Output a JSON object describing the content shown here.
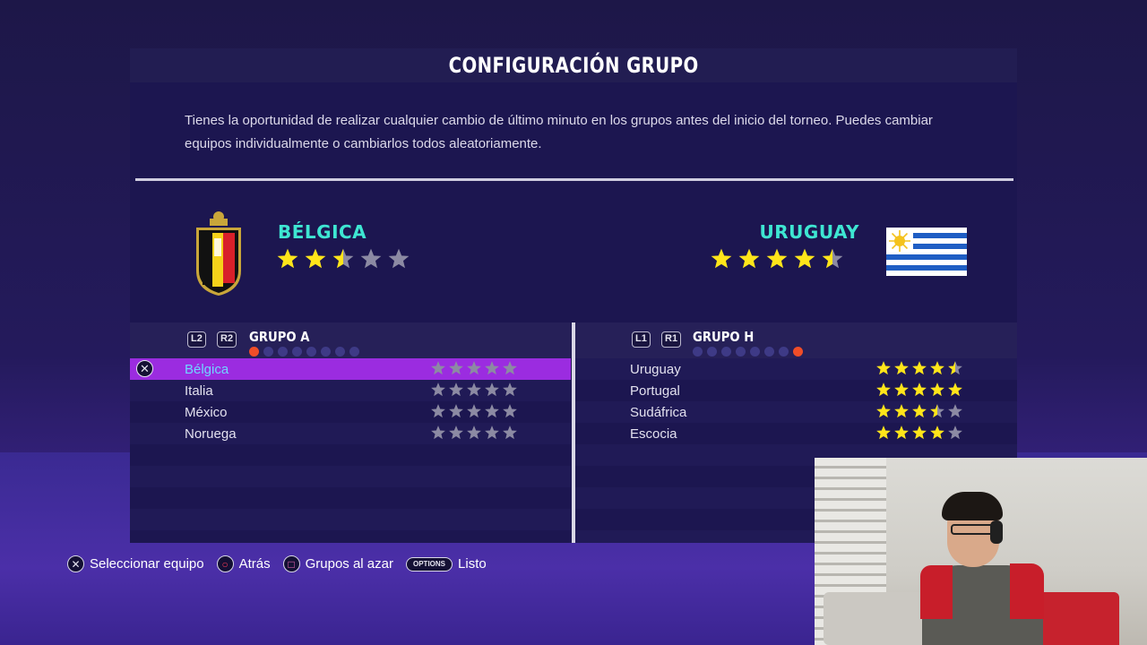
{
  "screen": {
    "title": "CONFIGURACIÓN GRUPO",
    "description": "Tienes la oportunidad de realizar cualquier cambio de último minuto en los grupos antes del inicio del torneo. Puedes cambiar equipos individualmente o cambiarlos todos aleatoriamente."
  },
  "team_left": {
    "name": "BÉLGICA",
    "rating": 2.5,
    "crest_icon": "belgium-crest-icon"
  },
  "team_right": {
    "name": "URUGUAY",
    "rating": 4.5,
    "flag_icon": "uruguay-flag-icon"
  },
  "group_left": {
    "shoulder_left": "L2",
    "shoulder_right": "R2",
    "name": "GRUPO A",
    "page_index": 0,
    "page_count": 8,
    "teams": [
      {
        "name": "Bélgica",
        "rating": 5,
        "selected": true
      },
      {
        "name": "Italia",
        "rating": 5
      },
      {
        "name": "México",
        "rating": 5
      },
      {
        "name": "Noruega",
        "rating": 5
      }
    ],
    "star_color": "grey"
  },
  "group_right": {
    "shoulder_left": "L1",
    "shoulder_right": "R1",
    "name": "GRUPO H",
    "page_index": 7,
    "page_count": 8,
    "teams": [
      {
        "name": "Uruguay",
        "rating": 4.5
      },
      {
        "name": "Portugal",
        "rating": 5
      },
      {
        "name": "Sudáfrica",
        "rating": 3.5
      },
      {
        "name": "Escocia",
        "rating": 4
      }
    ],
    "star_color": "yellow"
  },
  "footer": {
    "select_label": "Seleccionar equipo",
    "back_label": "Atrás",
    "random_label": "Grupos al azar",
    "options_badge": "OPTIONS",
    "done_label": "Listo"
  },
  "colors": {
    "accent_team": "#3ee6d2",
    "selection": "#9b2ce0",
    "active_dot": "#f04d28",
    "star_yellow": "#ffe51a",
    "star_grey": "#8c8aa3"
  }
}
